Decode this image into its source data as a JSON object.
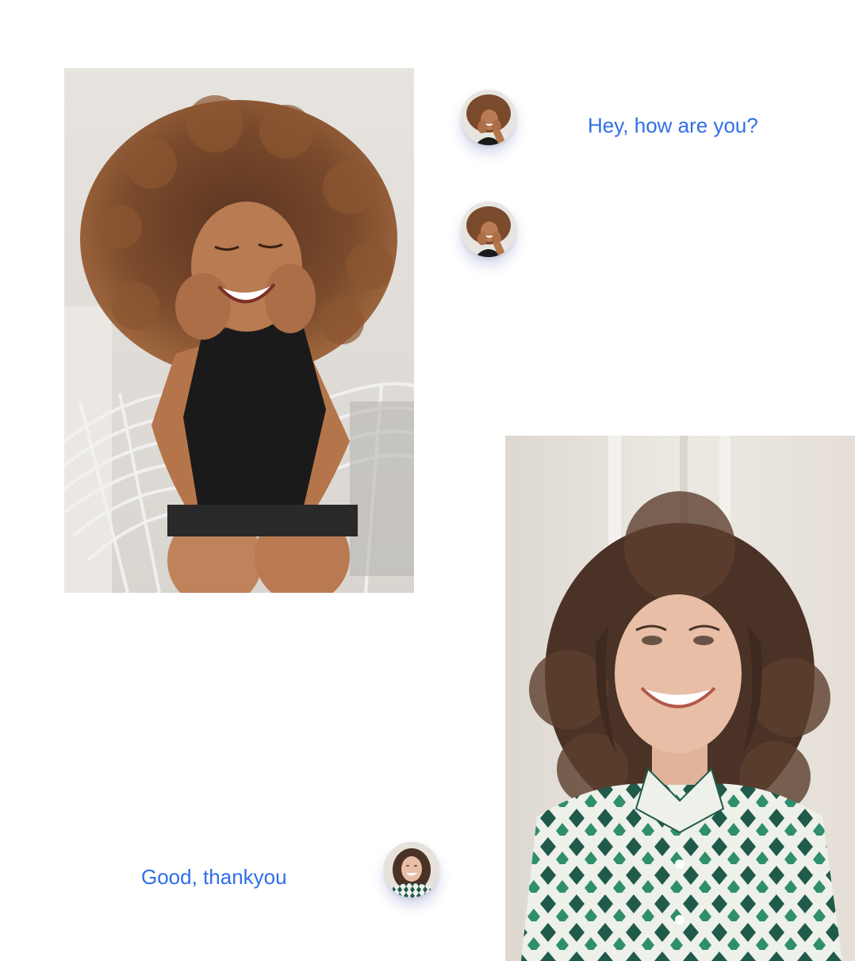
{
  "colors": {
    "message_text": "#2f6fe8",
    "background": "#ffffff",
    "avatar_shadow": "#3c46a0"
  },
  "photos": [
    {
      "name": "curly-hair-woman-photo",
      "subject": "smiling woman with curly hair sitting in a wire chair"
    },
    {
      "name": "wavy-hair-woman-photo",
      "subject": "smiling woman with wavy hair in a green patterned shirt"
    }
  ],
  "conversation": [
    {
      "sender": "curly-hair-woman",
      "text": "Hey, how are you?"
    },
    {
      "sender": "curly-hair-woman",
      "text": ""
    },
    {
      "sender": "wavy-hair-woman",
      "text": "Good, thankyou"
    }
  ]
}
